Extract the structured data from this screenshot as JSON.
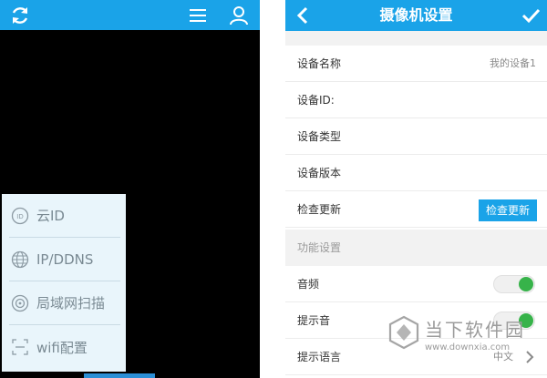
{
  "colors": {
    "accent": "#1aa3e8",
    "toggle_on": "#37b34a",
    "panel_bg": "#e9f5fb"
  },
  "left": {
    "icons": [
      "refresh-icon",
      "menu-icon",
      "user-icon"
    ],
    "menu": [
      {
        "label": "云ID",
        "icon": "id-icon"
      },
      {
        "label": "IP/DDNS",
        "icon": "globe-icon"
      },
      {
        "label": "局域网扫描",
        "icon": "scan-icon"
      },
      {
        "label": "wifi配置",
        "icon": "wifi-config-icon"
      }
    ]
  },
  "right": {
    "title": "摄像机设置",
    "rows": [
      {
        "label": "设备名称",
        "value": "我的设备1"
      },
      {
        "label": "设备ID:",
        "value": ""
      },
      {
        "label": "设备类型",
        "value": ""
      },
      {
        "label": "设备版本",
        "value": ""
      },
      {
        "label": "检查更新",
        "button": "检查更新"
      }
    ],
    "section": "功能设置",
    "feature_rows": [
      {
        "label": "音频",
        "on": true
      },
      {
        "label": "提示音",
        "on": true
      },
      {
        "label": "提示语言",
        "value": "中文"
      }
    ]
  },
  "watermark": {
    "name": "当下软件园",
    "url": "www.downxia.com"
  }
}
